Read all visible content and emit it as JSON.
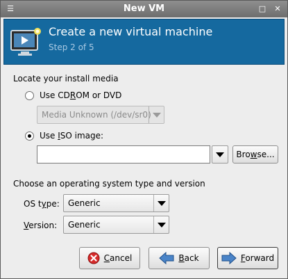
{
  "window": {
    "title": "New VM"
  },
  "titlebar": {
    "menu_glyph": "☰",
    "maximize_glyph": "□",
    "close_glyph": "✕"
  },
  "banner": {
    "title": "Create a new virtual machine",
    "step": "Step 2 of 5",
    "icon": "monitor-play-icon",
    "accent_color": "#15699f"
  },
  "install_media": {
    "section_label": "Locate your install media",
    "cdrom": {
      "label_pre": "Use CD",
      "label_u": "R",
      "label_post": "OM or DVD",
      "selected": false
    },
    "cdrom_device": {
      "value": "Media Unknown (/dev/sr0)",
      "enabled": false
    },
    "iso": {
      "label_pre": "Use ",
      "label_u": "I",
      "label_post": "SO image:",
      "selected": true
    },
    "iso_path": {
      "value": "",
      "placeholder": ""
    },
    "browse_button": {
      "label_pre": "Bro",
      "label_u": "w",
      "label_post": "se..."
    }
  },
  "os": {
    "section_label": "Choose an operating system type and version",
    "type": {
      "label_pre": "OS t",
      "label_u": "y",
      "label_post": "pe:",
      "value": "Generic"
    },
    "version": {
      "label_pre": "",
      "label_u": "V",
      "label_post": "ersion:",
      "value": "Generic"
    }
  },
  "buttons": {
    "cancel": {
      "label_pre": "",
      "label_u": "C",
      "label_post": "ancel",
      "icon": "cancel-icon"
    },
    "back": {
      "label_pre": "",
      "label_u": "B",
      "label_post": "ack",
      "icon": "back-arrow-icon"
    },
    "forward": {
      "label_pre": "",
      "label_u": "F",
      "label_post": "orward",
      "icon": "forward-arrow-icon"
    }
  }
}
